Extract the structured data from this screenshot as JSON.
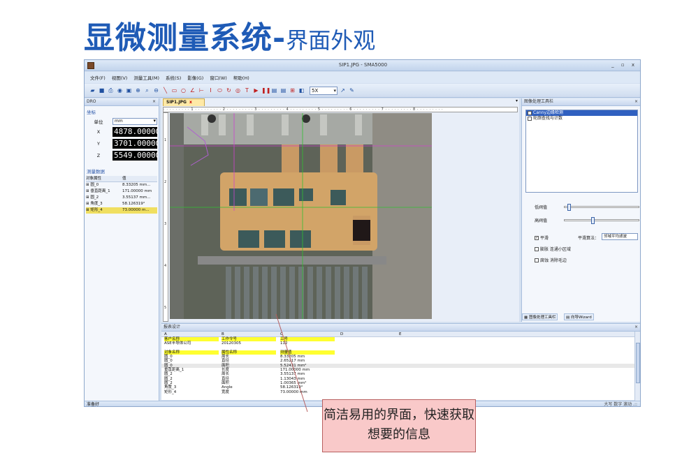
{
  "slide": {
    "title_main": "显微测量系统-",
    "title_sub": "界面外观",
    "callout": "简洁易用的界面，快速获取想要的信息"
  },
  "app": {
    "title": "SIP1.JPG - SMA5000",
    "controls": "_ ▫ x",
    "menu": [
      "文件(F)",
      "视图(V)",
      "测量工具(M)",
      "系统(S)",
      "影像(G)",
      "窗口(W)",
      "帮助(H)"
    ],
    "toolbar_zoom": "5X",
    "status_left": "准备好",
    "status_right": "大写 数字 滚动 .::"
  },
  "dro": {
    "title": "DRO",
    "section": "坐标",
    "unit_label": "单位",
    "unit_value": "mm",
    "x_label": "X",
    "x_value": "4878.000000",
    "y_label": "Y",
    "y_value": "3701.000000",
    "z_label": "Z",
    "z_value": "5549.000000",
    "mdata_title": "测量数据",
    "col_obj": "对象属性",
    "col_val": "值",
    "rows": [
      {
        "obj": "⊞ 圆_0",
        "val": "8.33205 mm..."
      },
      {
        "obj": "⊞ 垂直距离_1",
        "val": "171.00000 mm"
      },
      {
        "obj": "⊞ 圆_2",
        "val": "3.55137 mm..."
      },
      {
        "obj": "⊞ 角度_3",
        "val": "58.126319°"
      },
      {
        "obj": "⊞ 矩形_4",
        "val": "73.00000 m..."
      }
    ]
  },
  "doc": {
    "tab": "SIP1.JPG",
    "close": "x",
    "ruler": "· · · · · · · · · 1 · · · · · · · · · 2 · · · · · · · · · 3 · · · · · · · · · 4 · · · · · · · · · 5 · · · · · · · · · 6 · · · · · · · · · 7 · · · · · · · · · 8 · · · · · · · · ·"
  },
  "imgtool": {
    "title": "图像处理工具栏",
    "items": [
      "Canny边缘检测",
      "轮廓查找与计数"
    ],
    "low": "低阀值",
    "high": "高阀值",
    "low_level": 0.04,
    "high_level": 0.38,
    "smooth": "平滑",
    "smooth_algo_label": "平滑算法：",
    "smooth_algo": "邻域平均滤波",
    "opt1": "膨胀 连通小区域",
    "opt2": "腐蚀 消除毛边",
    "tab1": "图像处理工具栏",
    "tab2": "向导Wizard"
  },
  "report": {
    "title": "报表设计",
    "cols": [
      "A",
      "B",
      "C",
      "D",
      "E"
    ],
    "rows": [
      {
        "a": "客户名称",
        "b": "工作令号",
        "c": "工号",
        "y": true
      },
      {
        "a": "ASE半导体公司",
        "b": "20120305",
        "c": "112"
      },
      {
        "a": "",
        "b": "",
        "c": ""
      },
      {
        "a": "对象名称",
        "b": "属性名称",
        "c": "测量值",
        "y": true
      },
      {
        "a": "圆_0",
        "b": "周长",
        "c": "8.33205 mm"
      },
      {
        "a": "圆_0",
        "b": "直径",
        "c": "2.65217 mm"
      },
      {
        "a": "圆_0",
        "b": "面积",
        "c": "5.52431 mm²",
        "z": true
      },
      {
        "a": "垂直距离_1",
        "b": "长度",
        "c": "171.00000 mm"
      },
      {
        "a": "圆_2",
        "b": "周长",
        "c": "3.55137 mm"
      },
      {
        "a": "圆_2",
        "b": "直径",
        "c": "1.13043 mm"
      },
      {
        "a": "圆_2",
        "b": "面积",
        "c": "1.00365 mm²"
      },
      {
        "a": "角度_3",
        "b": "Angle",
        "c": "58.126319°"
      },
      {
        "a": "矩形_4",
        "b": "宽度",
        "c": "73.00000 mm"
      }
    ]
  }
}
